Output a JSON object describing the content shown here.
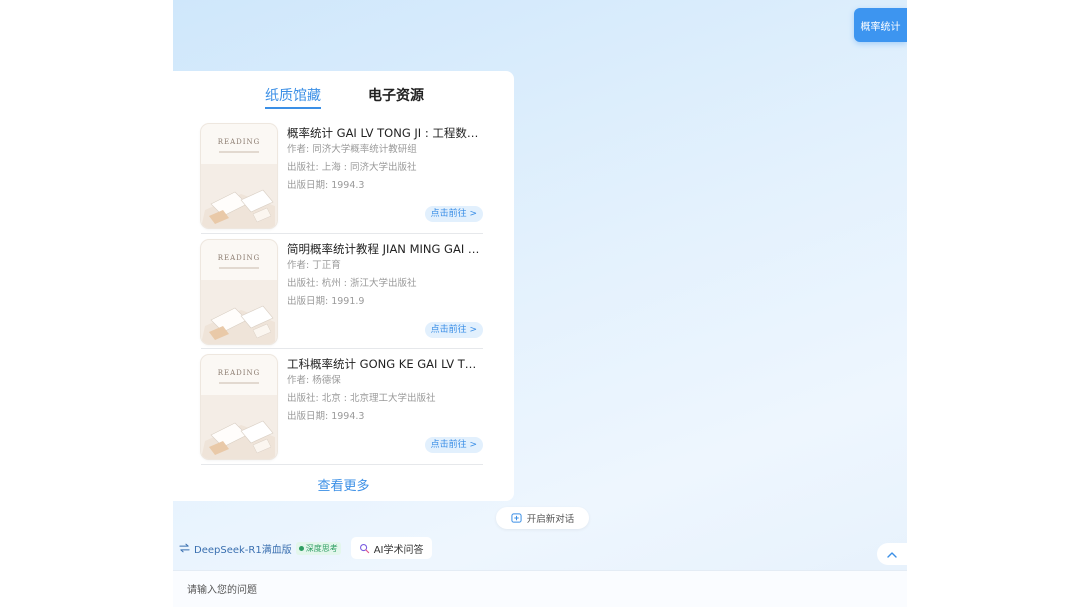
{
  "query_bubble": "概率统计",
  "tabs": {
    "paper": "纸质馆藏",
    "ebook": "电子资源"
  },
  "books": [
    {
      "cover_word": "READING",
      "title": "概率统计 GAI LV TONG JI : 工程数学 ...",
      "author": "作者: 同济大学概率统计教研组",
      "publisher": "出版社: 上海 : 同济大学出版社",
      "date": "出版日期: 1994.3",
      "go": "点击前往 >"
    },
    {
      "cover_word": "READING",
      "title": "简明概率统计教程 JIAN MING GAI LV...",
      "author": "作者: 丁正育",
      "publisher": "出版社: 杭州 : 浙江大学出版社",
      "date": "出版日期: 1991.9",
      "go": "点击前往 >"
    },
    {
      "cover_word": "READING",
      "title": "工科概率统计 GONG KE GAI LV TON...",
      "author": "作者: 杨德保",
      "publisher": "出版社: 北京 : 北京理工大学出版社",
      "date": "出版日期: 1994.3",
      "go": "点击前往 >"
    }
  ],
  "view_more": "查看更多",
  "new_chat": "开启新对话",
  "model": {
    "name": "DeepSeek-R1满血版",
    "deep_think": "深度思考",
    "icon": "swap-icon"
  },
  "ai_chip": "AI学术问答",
  "input": {
    "placeholder": "请输入您的问题",
    "value": ""
  },
  "colors": {
    "accent": "#3b8fe6",
    "badge_green": "#2e9e62",
    "bubble": "#3d95f0"
  }
}
